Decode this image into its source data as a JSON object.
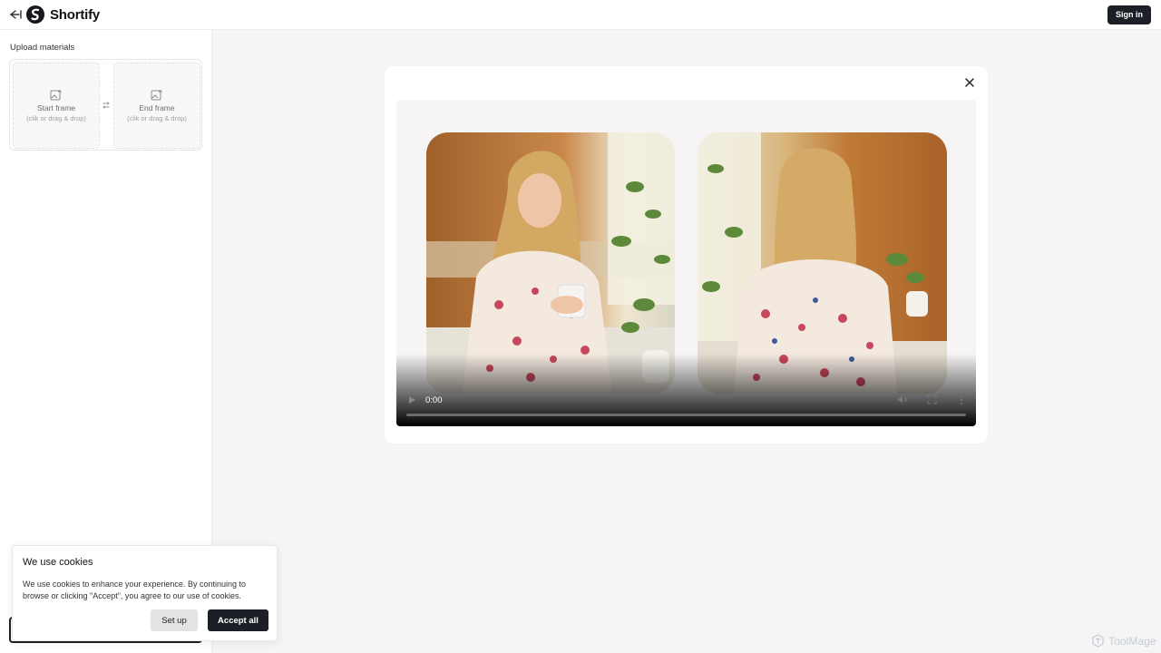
{
  "header": {
    "brand": "Shortify",
    "sign_in_label": "Sign in"
  },
  "sidebar": {
    "upload_title": "Upload materials",
    "start_frame": {
      "label": "Start frame",
      "hint": "(clik or drag & drop)"
    },
    "end_frame": {
      "label": "End frame",
      "hint": "(clik or drag & drop)"
    }
  },
  "player": {
    "time": "0:00",
    "progress": 0,
    "frames": [
      {
        "description": "woman-facing-camera-holding-mug"
      },
      {
        "description": "woman-facing-away-kitchen"
      }
    ]
  },
  "cookie": {
    "title": "We use cookies",
    "text": "We use cookies to enhance your experience. By continuing to browse or clicking \"Accept\", you agree to our use of cookies.",
    "setup_label": "Set up",
    "accept_label": "Accept all"
  },
  "watermark": {
    "text": "ToolMage"
  },
  "colors": {
    "dark": "#1c1f26",
    "background": "#f5f5f5",
    "panel_bg": "#ffffff"
  }
}
